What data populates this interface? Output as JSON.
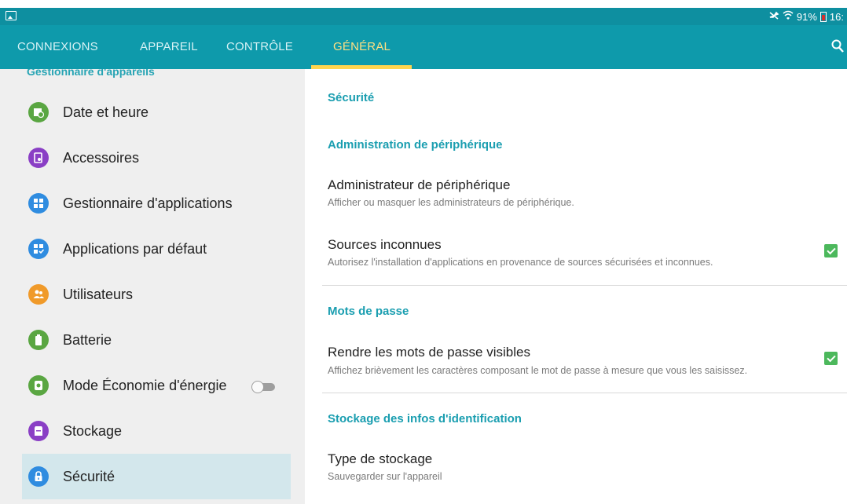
{
  "status_bar": {
    "battery": "91%",
    "time": "16:"
  },
  "tabs": [
    {
      "label": "CONNEXIONS"
    },
    {
      "label": "APPAREIL"
    },
    {
      "label": "CONTRÔLE"
    },
    {
      "label": "GÉNÉRAL"
    }
  ],
  "sidebar": {
    "header": "Gestionnaire d'appareils",
    "items": [
      {
        "label": "Date et heure",
        "color": "#5aa642"
      },
      {
        "label": "Accessoires",
        "color": "#8a3fc5"
      },
      {
        "label": "Gestionnaire d'applications",
        "color": "#2f8ce0"
      },
      {
        "label": "Applications par défaut",
        "color": "#2f8ce0"
      },
      {
        "label": "Utilisateurs",
        "color": "#f09a2a"
      },
      {
        "label": "Batterie",
        "color": "#5aa642"
      },
      {
        "label": "Mode Économie d'énergie",
        "color": "#5aa642",
        "toggle_on": false
      },
      {
        "label": "Stockage",
        "color": "#8a3fc5"
      },
      {
        "label": "Sécurité",
        "color": "#2f8ce0"
      }
    ]
  },
  "content": {
    "page_title": "Sécurité",
    "sections": [
      {
        "header": "Administration de périphérique",
        "items": [
          {
            "title": "Administrateur de périphérique",
            "subtitle": "Afficher ou masquer les administrateurs de périphérique."
          },
          {
            "title": "Sources inconnues",
            "subtitle": "Autorisez l'installation d'applications en provenance de sources sécurisées et inconnues.",
            "checked": true
          }
        ]
      },
      {
        "header": "Mots de passe",
        "items": [
          {
            "title": "Rendre les mots de passe visibles",
            "subtitle": "Affichez brièvement les caractères composant le mot de passe à mesure que vous les saisissez.",
            "checked": true
          }
        ]
      },
      {
        "header": "Stockage des infos d'identification",
        "items": [
          {
            "title": "Type de stockage",
            "subtitle": "Sauvegarder sur l'appareil"
          }
        ]
      }
    ]
  },
  "colors": {
    "status_bar": "#0e8fa0",
    "tab_bar": "#0e9aab",
    "accent": "#1a9eb0",
    "active_tab": "#ffe082",
    "checkbox": "#4cb85c"
  }
}
